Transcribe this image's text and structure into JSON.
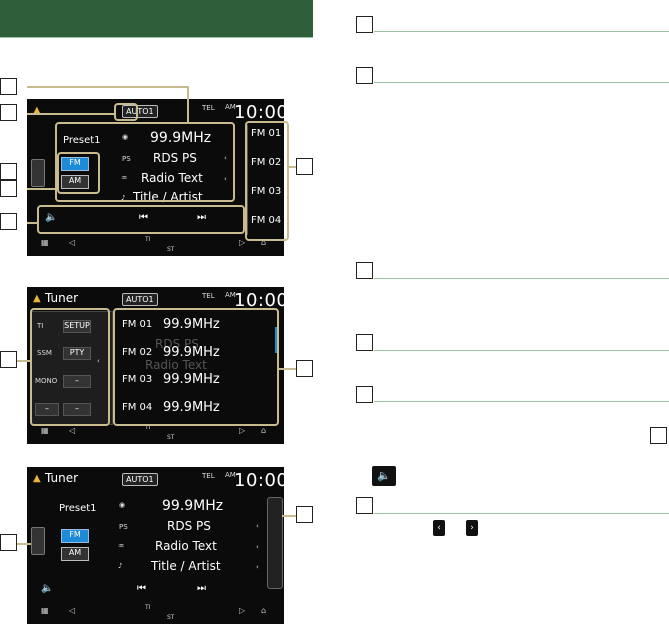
{
  "screens": [
    {
      "title": "",
      "auto": "AUTO1",
      "tel": "TEL",
      "am_pm": "AM",
      "time": "10:00",
      "preset": "Preset1",
      "frequency": "99.9MHz",
      "ps_label": "PS",
      "rds_ps": "RDS PS",
      "radio_text": "Radio Text",
      "title_artist": "Title / Artist",
      "band_fm": "FM",
      "band_am": "AM",
      "presets": [
        "FM 01",
        "FM 02",
        "FM 03",
        "FM 04"
      ]
    },
    {
      "title": "Tuner",
      "auto": "AUTO1",
      "tel": "TEL",
      "am_pm": "AM",
      "time": "10:00",
      "left_buttons": [
        "TI",
        "SETUP",
        "SSM",
        "PTY",
        "MONO",
        "–",
        "–",
        "–"
      ],
      "presets": [
        {
          "name": "FM 01",
          "freq": "99.9MHz"
        },
        {
          "name": "FM 02",
          "freq": "99.9MHz"
        },
        {
          "name": "FM 03",
          "freq": "99.9MHz"
        },
        {
          "name": "FM 04",
          "freq": "99.9MHz"
        }
      ],
      "bg_labels": [
        "RDS PS",
        "Radio Text"
      ]
    },
    {
      "title": "Tuner",
      "auto": "AUTO1",
      "tel": "TEL",
      "am_pm": "AM",
      "time": "10:00",
      "preset": "Preset1",
      "frequency": "99.9MHz",
      "ps_label": "PS",
      "rds_ps": "RDS PS",
      "radio_text": "Radio Text",
      "title_artist": "Title / Artist",
      "band_fm": "FM",
      "band_am": "AM"
    }
  ],
  "ti_label": "TI",
  "st_label": "ST",
  "right_col": {
    "boxes": 7
  }
}
